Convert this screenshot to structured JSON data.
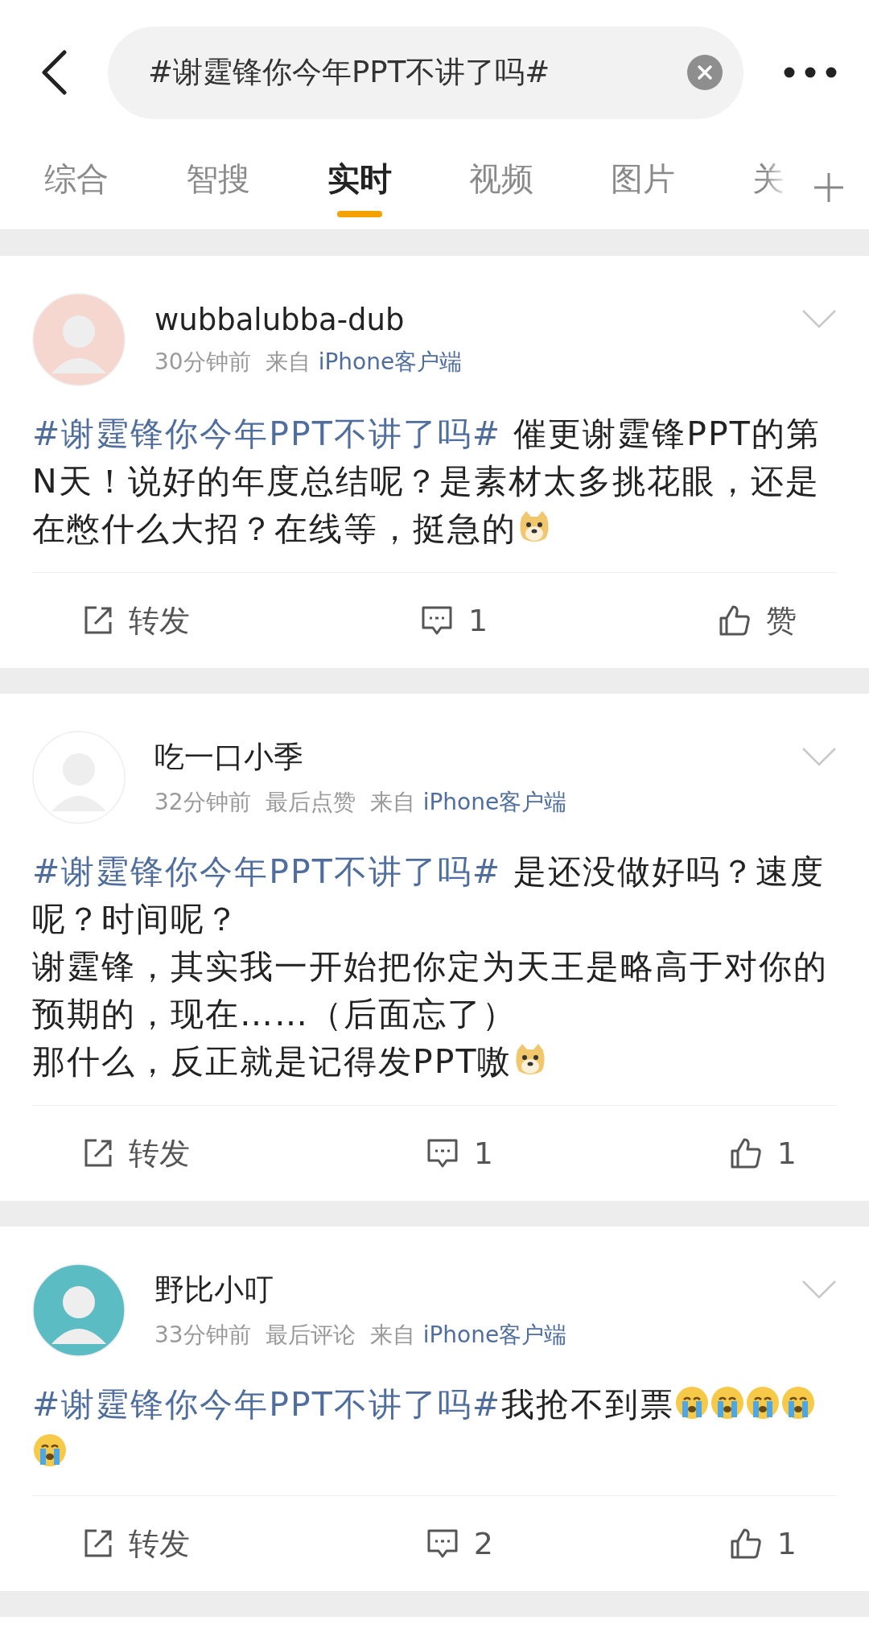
{
  "search": {
    "value": "#谢霆锋你今年PPT不讲了吗#"
  },
  "tabs": [
    {
      "label": "综合",
      "selected": false
    },
    {
      "label": "智搜",
      "selected": false
    },
    {
      "label": "实时",
      "selected": true
    },
    {
      "label": "视频",
      "selected": false
    },
    {
      "label": "图片",
      "selected": false
    },
    {
      "label": "关",
      "selected": false
    }
  ],
  "posts": [
    {
      "avatar": {
        "color": "#f6d7cf"
      },
      "name": "wubbalubba-dub",
      "time": "30分钟前",
      "from": "来自",
      "source": "iPhone客户端",
      "hashtag": "#谢霆锋你今年PPT不讲了吗#",
      "lines": [
        " 催更谢霆锋PPT的第N天！说好的年度总结呢？是素材太多挑花眼，还是在憋什么大招？在线等，挺急的"
      ],
      "emojis": [
        {
          "kind": "doge"
        }
      ],
      "repost": "转发",
      "comments": "1",
      "likes": "赞"
    },
    {
      "avatar": {
        "color": "#ffffff"
      },
      "name": "吃一口小季",
      "time": "32分钟前",
      "extra": "最后点赞",
      "from": "来自",
      "source": "iPhone客户端",
      "hashtag": "#谢霆锋你今年PPT不讲了吗#",
      "lines": [
        " 是还没做好吗？速度呢？时间呢？",
        "谢霆锋，其实我一开始把你定为天王是略高于对你的预期的，现在……（后面忘了）",
        "那什么，反正就是记得发PPT嗷"
      ],
      "emojis": [
        {
          "kind": "doge"
        }
      ],
      "repost": "转发",
      "comments": "1",
      "likes": "1"
    },
    {
      "avatar": {
        "color": "#5bbcc4"
      },
      "name": "野比小叮",
      "time": "33分钟前",
      "extra": "最后评论",
      "from": "来自",
      "source": "iPhone客户端",
      "hashtag": "#谢霆锋你今年PPT不讲了吗#",
      "lines": [
        "我抢不到票"
      ],
      "emojis": [
        {
          "kind": "cry"
        },
        {
          "kind": "cry"
        },
        {
          "kind": "cry"
        },
        {
          "kind": "cry"
        },
        {
          "kind": "cry"
        }
      ],
      "repost": "转发",
      "comments": "2",
      "likes": "1"
    }
  ]
}
